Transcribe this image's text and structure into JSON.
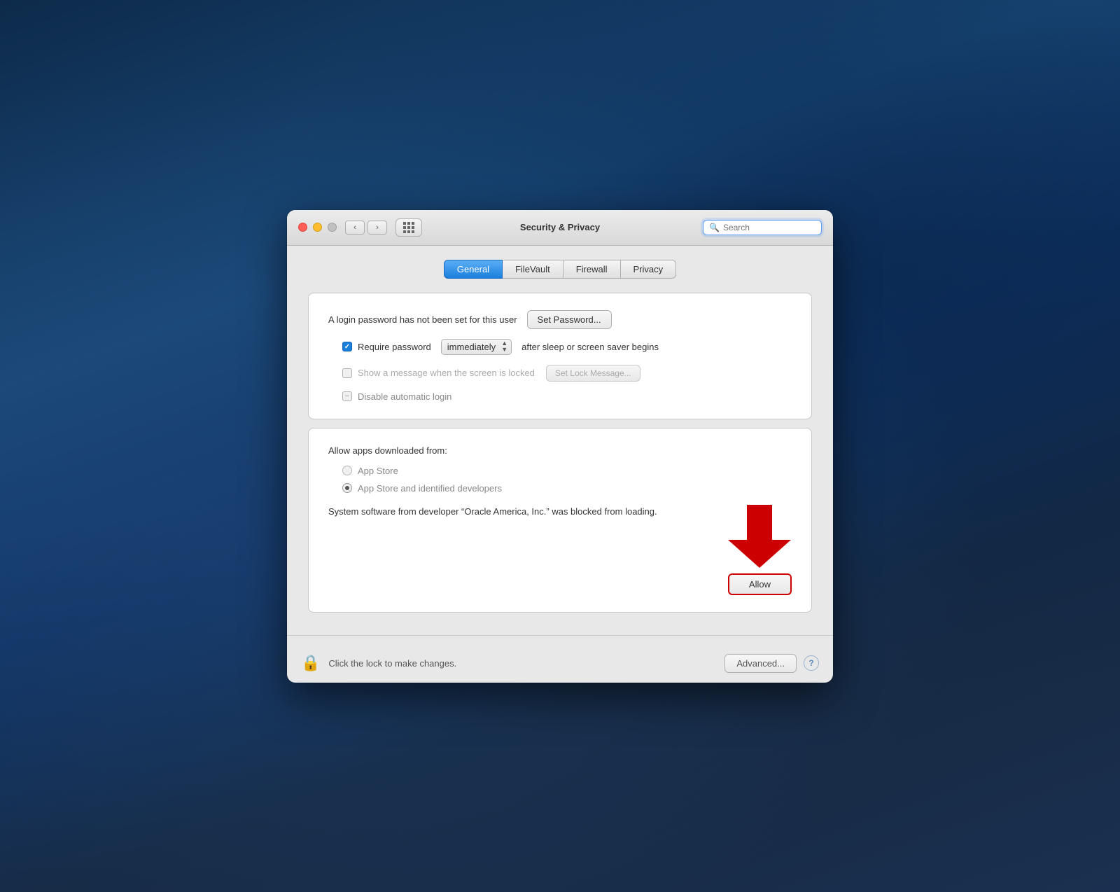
{
  "desktop": {
    "bg_note": "macOS Catalina mountains/ocean background"
  },
  "window": {
    "title": "Security & Privacy",
    "search_placeholder": "Search"
  },
  "tabs": [
    {
      "id": "general",
      "label": "General",
      "active": true
    },
    {
      "id": "filevault",
      "label": "FileVault",
      "active": false
    },
    {
      "id": "firewall",
      "label": "Firewall",
      "active": false
    },
    {
      "id": "privacy",
      "label": "Privacy",
      "active": false
    }
  ],
  "panel1": {
    "login_password_text": "A login password has not been set for this user",
    "set_password_label": "Set Password...",
    "require_password_label": "Require password",
    "require_password_checked": true,
    "immediately_value": "immediately",
    "after_sleep_text": "after sleep or screen saver begins",
    "show_message_label": "Show a message when the screen is locked",
    "show_message_checked": false,
    "set_lock_message_label": "Set Lock Message...",
    "disable_autologin_label": "Disable automatic login",
    "disable_autologin_checked": true
  },
  "panel2": {
    "allow_apps_title": "Allow apps downloaded from:",
    "radio_app_store": "App Store",
    "radio_app_store_checked": false,
    "radio_app_store_identified": "App Store and identified developers",
    "radio_app_store_identified_checked": true,
    "blocked_text": "System software from developer “Oracle America, Inc.” was blocked from loading.",
    "allow_label": "Allow"
  },
  "bottom": {
    "lock_text": "Click the lock to make changes.",
    "advanced_label": "Advanced...",
    "help_label": "?"
  },
  "icons": {
    "close": "traffic-light-close",
    "minimize": "traffic-light-minimize",
    "maximize": "traffic-light-maximize",
    "back": "chevron-left",
    "forward": "chevron-right",
    "grid": "grid-view",
    "search": "magnifier",
    "lock": "padlock"
  }
}
